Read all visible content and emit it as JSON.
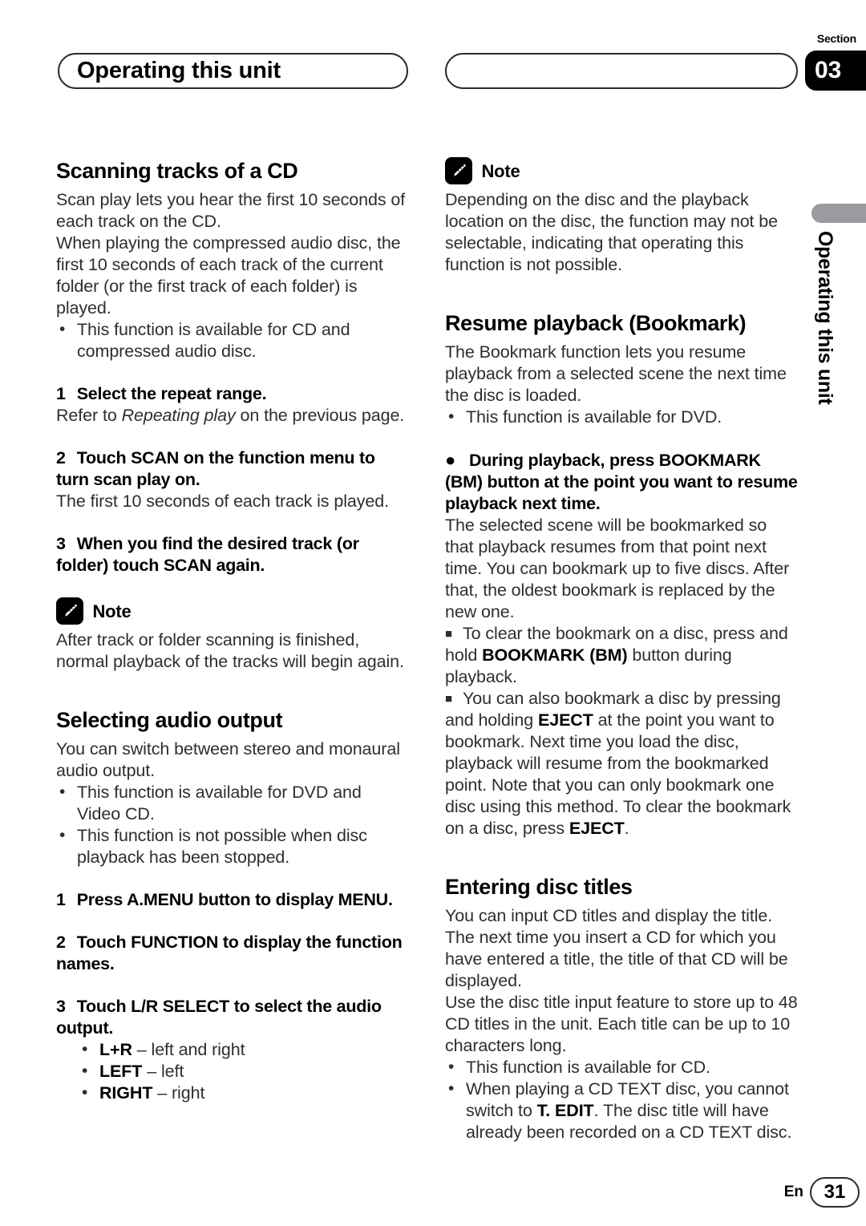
{
  "header": {
    "title": "Operating this unit",
    "section_label": "Section",
    "section_number": "03"
  },
  "side_tab": {
    "text": "Operating this unit",
    "bar_color": "#9a9ba0"
  },
  "left_column": {
    "heading_1": "Scanning tracks of a CD",
    "intro_1": "Scan play lets you hear the first 10 seconds of each track on the CD.",
    "intro_2": "When playing the compressed audio disc, the first 10 seconds of each track of the current folder (or the first track of each folder) is played.",
    "bullets_1": [
      "This function is available for CD and compressed audio disc."
    ],
    "step_1_num": "1",
    "step_1_text": "Select the repeat range.",
    "step_1_body_pre": "Refer to ",
    "step_1_body_italic": "Repeating play",
    "step_1_body_post": " on the previous page.",
    "step_2_num": "2",
    "step_2_text": "Touch SCAN on the function menu to turn scan play on.",
    "step_2_body": "The first 10 seconds of each track is played.",
    "step_3_num": "3",
    "step_3_text": "When you find the desired track (or folder) touch SCAN again.",
    "note_label": "Note",
    "note_body": "After track or folder scanning is finished, normal playback of the tracks will begin again.",
    "heading_2": "Selecting audio output",
    "intro_3": "You can switch between stereo and monaural audio output.",
    "bullets_2": [
      "This function is available for DVD and Video CD.",
      "This function is not possible when disc playback has been stopped."
    ],
    "step_4_num": "1",
    "step_4_text": "Press A.MENU button to display MENU.",
    "step_5_num": "2",
    "step_5_text": "Touch FUNCTION to display the function names.",
    "step_6_num": "3",
    "step_6_text": "Touch L/R SELECT to select the audio output.",
    "options": [
      {
        "key": "L+R",
        "desc": " – left and right"
      },
      {
        "key": "LEFT",
        "desc": " – left"
      },
      {
        "key": "RIGHT",
        "desc": " – right"
      }
    ]
  },
  "right_column": {
    "note_label": "Note",
    "note_body": "Depending on the disc and the playback location on the disc, the function may not be selectable, indicating that operating this function is not possible.",
    "heading_1": "Resume playback (Bookmark)",
    "intro_1": "The Bookmark function lets you resume playback from a selected scene the next time the disc is loaded.",
    "bullets_1": [
      "This function is available for DVD."
    ],
    "big_bullet_text": "During playback, press BOOKMARK (BM) button at the point you want to resume playback next time.",
    "body_1": "The selected scene will be bookmarked so that playback resumes from that point next time. You can bookmark up to five discs. After that, the oldest bookmark is replaced by the new one.",
    "square_1_pre": "To clear the bookmark on a disc, press and hold ",
    "square_1_bold": "BOOKMARK (BM)",
    "square_1_post": " button during playback.",
    "square_2_pre": "You can also bookmark a disc by pressing and holding ",
    "square_2_bold": "EJECT",
    "square_2_mid": " at the point you want to bookmark. Next time you load the disc, playback will resume from the bookmarked point. Note that you can only bookmark one disc using this method. To clear the bookmark on a disc, press ",
    "square_2_bold2": "EJECT",
    "square_2_post": ".",
    "heading_2": "Entering disc titles",
    "intro_2": "You can input CD titles and display the title. The next time you insert a CD for which you have entered a title, the title of that CD will be displayed.",
    "intro_3": "Use the disc title input feature to store up to 48 CD titles in the unit. Each title can be up to 10 characters long.",
    "bullets_2_first": "This function is available for CD.",
    "bullets_2_second_pre": "When playing a CD TEXT disc, you cannot switch to ",
    "bullets_2_second_bold": "T. EDIT",
    "bullets_2_second_post": ". The disc title will have already been recorded on a CD TEXT disc."
  },
  "footer": {
    "language": "En",
    "page_number": "31"
  }
}
